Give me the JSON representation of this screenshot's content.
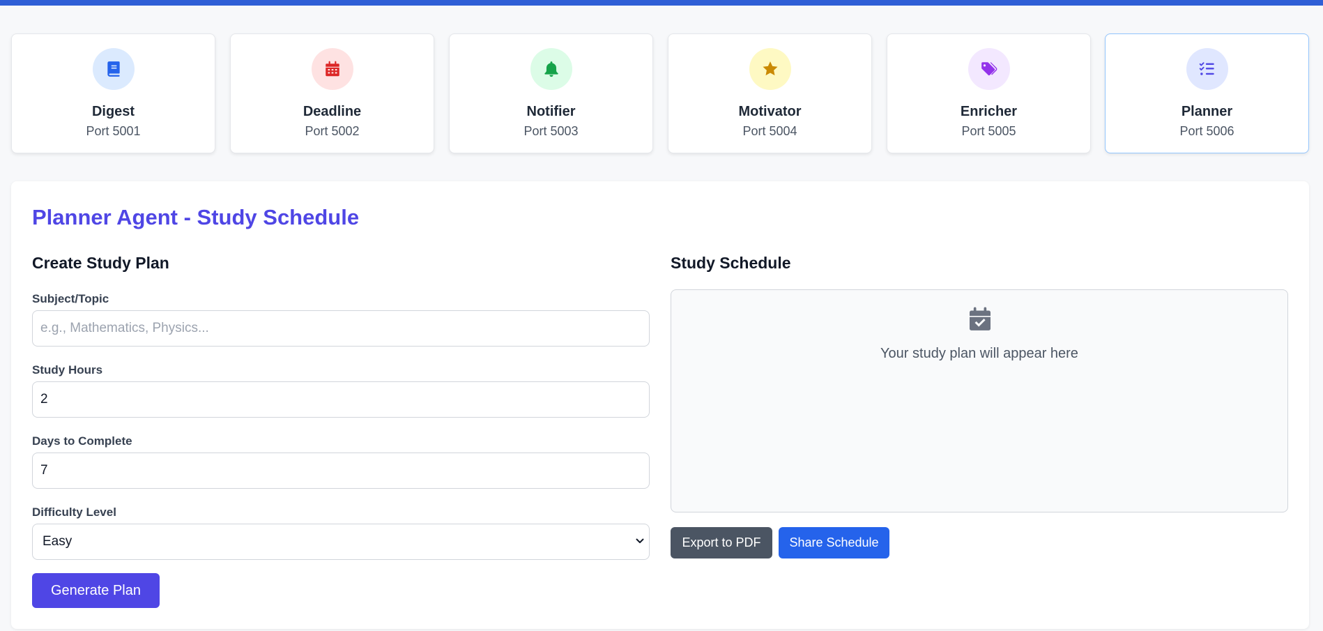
{
  "agents": [
    {
      "name": "Digest",
      "port": "Port 5001",
      "icon": "book-icon",
      "color": "#2563eb",
      "bg": "#dbeafe"
    },
    {
      "name": "Deadline",
      "port": "Port 5002",
      "icon": "calendar-icon",
      "color": "#dc2626",
      "bg": "#fee2e2"
    },
    {
      "name": "Notifier",
      "port": "Port 5003",
      "icon": "bell-icon",
      "color": "#16a34a",
      "bg": "#dcfce7"
    },
    {
      "name": "Motivator",
      "port": "Port 5004",
      "icon": "star-icon",
      "color": "#ca8a04",
      "bg": "#fef9c3"
    },
    {
      "name": "Enricher",
      "port": "Port 5005",
      "icon": "tags-icon",
      "color": "#9333ea",
      "bg": "#f3e8ff"
    },
    {
      "name": "Planner",
      "port": "Port 5006",
      "icon": "list-check-icon",
      "color": "#4f46e5",
      "bg": "#e0e7ff",
      "active": true
    }
  ],
  "panel": {
    "title": "Planner Agent - Study Schedule"
  },
  "form": {
    "title": "Create Study Plan",
    "subject_label": "Subject/Topic",
    "subject_placeholder": "e.g., Mathematics, Physics...",
    "subject_value": "",
    "hours_label": "Study Hours",
    "hours_value": "2",
    "days_label": "Days to Complete",
    "days_value": "7",
    "difficulty_label": "Difficulty Level",
    "difficulty_value": "Easy",
    "generate_label": "Generate Plan"
  },
  "schedule": {
    "title": "Study Schedule",
    "empty_text": "Your study plan will appear here",
    "icon": "calendar-check-icon",
    "export_label": "Export to PDF",
    "share_label": "Share Schedule"
  },
  "colors": {
    "accent": "#4f46e5",
    "topbar": "#2f5fd6",
    "share": "#2563eb",
    "export": "#4b5563"
  }
}
